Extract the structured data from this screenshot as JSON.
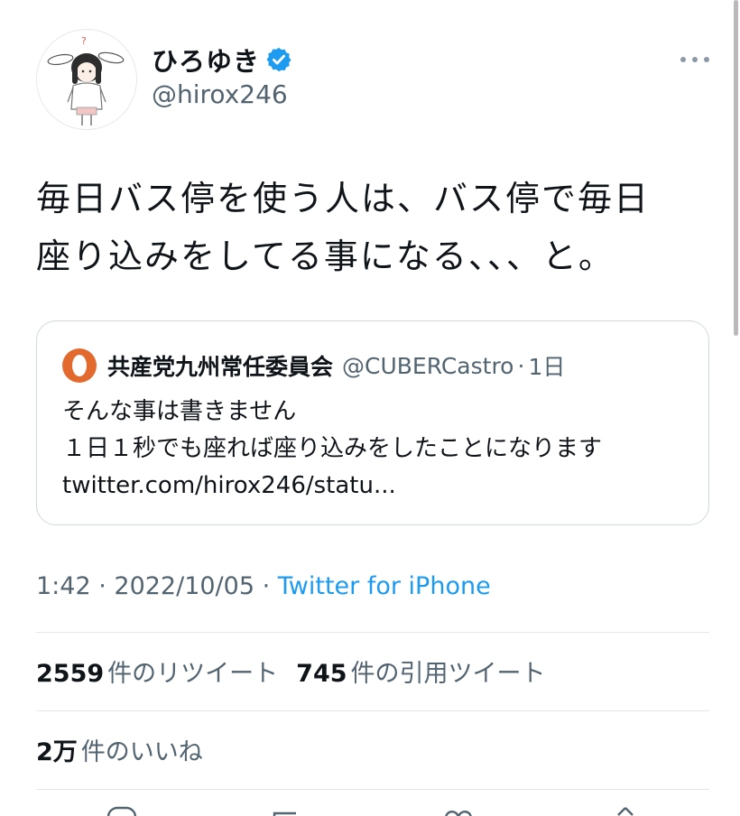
{
  "author": {
    "display_name": "ひろゆき",
    "handle": "@hirox246",
    "verified": true,
    "avatar_icon": "bunny-girl-avatar-icon"
  },
  "menu": {
    "more_icon": "more-dots-icon"
  },
  "tweet": {
    "text_line_1": "毎日バス停を使う人は、バス停で毎日",
    "text_line_2": "座り込みをしてる事になる、、、と。"
  },
  "quote": {
    "avatar_icon": "orange-circle-avatar-icon",
    "display_name": "共産党九州常任委員会",
    "handle": "@CUBERCastro",
    "separator": "·",
    "time": "1日",
    "text_line_1": "そんな事は書きません",
    "text_line_2": "１日１秒でも座れば座り込みをしたことになります",
    "text_line_3": "twitter.com/hirox246/statu..."
  },
  "meta": {
    "time": "1:42",
    "separator_1": " · ",
    "date": "2022/10/05",
    "separator_2": " · ",
    "source": "Twitter for iPhone"
  },
  "stats": {
    "retweets_count": "2559",
    "retweets_label": "件のリツイート",
    "quotes_count": "745",
    "quotes_label": "件の引用ツイート",
    "likes_count": "2万",
    "likes_label": "件のいいね"
  },
  "colors": {
    "accent": "#1d9bf0",
    "secondary_text": "#536471",
    "primary_text": "#0f1419",
    "quote_avatar": "#e36a2e"
  }
}
